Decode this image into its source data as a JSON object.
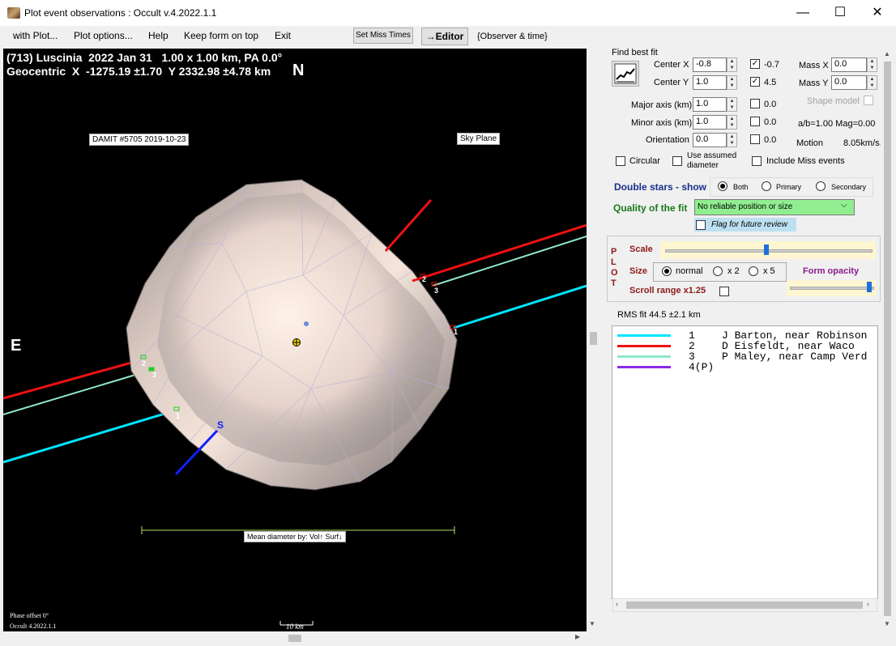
{
  "window": {
    "title": "Plot event observations : Occult v.4.2022.1.1",
    "minimize": "—",
    "maximize": "☐",
    "close": "✕"
  },
  "menu": {
    "items": [
      "with Plot...",
      "Plot options...",
      "Help",
      "Keep form on top",
      "Exit"
    ],
    "set_miss_times": "Set Miss Times",
    "editor": "→Editor",
    "observer_time": "{Observer & time}"
  },
  "plot": {
    "header_line1": "(713) Luscinia  2022 Jan 31   1.00 x 1.00 km, PA 0.0°",
    "header_line2": "Geocentric  X  -1275.19 ±1.70  Y 2332.98 ±4.78 km",
    "north": "N",
    "east": "E",
    "south": "S",
    "damit_label": "DAMIT #5705 2019-10-23",
    "sky_plane": "Sky Plane",
    "mean_diameter": "Mean diameter by: Vol↑ Surf↓",
    "phase_offset": "Phase offset 0°",
    "occult_version": "Occult 4.2022.1.1",
    "scale_bar": "10 km",
    "chord_labels": [
      "1",
      "2",
      "3",
      "1",
      "2",
      "3"
    ]
  },
  "fit": {
    "find_best_fit": "Find best fit",
    "center_x_label": "Center X",
    "center_x": "-0.8",
    "center_x_check": "-0.7",
    "center_y_label": "Center Y",
    "center_y": "1.0",
    "center_y_check": "4.5",
    "mass_x_label": "Mass X",
    "mass_x": "0.0",
    "mass_y_label": "Mass Y",
    "mass_y": "0.0",
    "shape_model": "Shape model",
    "major_label": "Major axis (km)",
    "major": "1.0",
    "major_check": "0.0",
    "minor_label": "Minor axis (km)",
    "minor": "1.0",
    "minor_check": "0.0",
    "ab_mag": "a/b=1.00  Mag=0.00",
    "orientation_label": "Orientation",
    "orientation": "0.0",
    "orientation_check": "0.0",
    "motion_label": "Motion",
    "motion": "8.05km/s.",
    "circular": "Circular",
    "use_assumed": "Use assumed diameter",
    "include_miss": "Include Miss events",
    "double_stars": "Double stars - show",
    "both": "Both",
    "primary": "Primary",
    "secondary": "Secondary",
    "quality_label": "Quality of the fit",
    "quality_value": "No reliable position or size",
    "flag_review": "Flag for future review"
  },
  "plotpanel": {
    "plot_vertical": "P L O T",
    "scale": "Scale",
    "size": "Size",
    "normal": "normal",
    "x2": "x 2",
    "x5": "x 5",
    "form_opacity": "Form opacity",
    "scroll_range": "Scroll range x1.25",
    "rms_fit": "RMS fit 44.5 ±2.1 km"
  },
  "legend": [
    {
      "num": "1",
      "name": "J Barton, near Robinson",
      "color": "#00e5ff"
    },
    {
      "num": "2",
      "name": "D Eisfeldt, near Waco",
      "color": "#ee1111"
    },
    {
      "num": "3",
      "name": "P Maley, near Camp Verd",
      "color": "#8fe8c8"
    },
    {
      "num": "4(P)",
      "name": "",
      "color": "#8a2be2"
    }
  ]
}
